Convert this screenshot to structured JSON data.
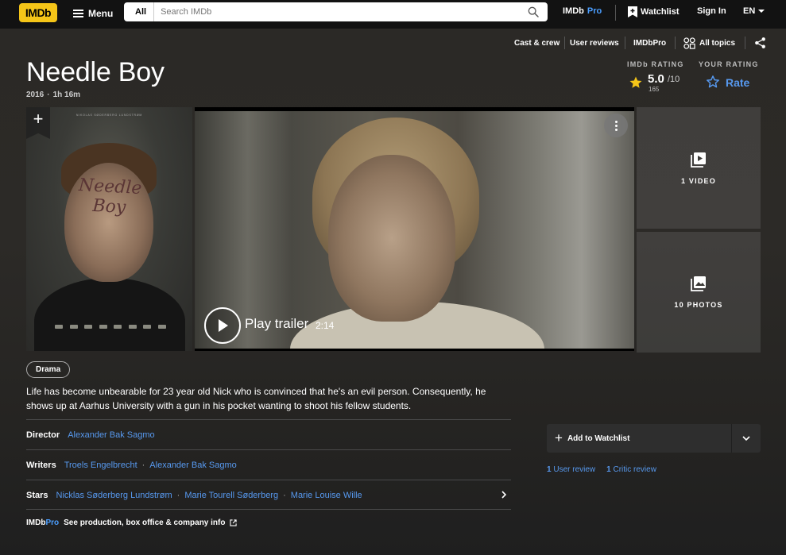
{
  "nav": {
    "logo": "IMDb",
    "menu_label": "Menu",
    "search_category": "All",
    "search_placeholder": "Search IMDb",
    "pro_prefix": "IMDb",
    "pro_suffix": "Pro",
    "watchlist_label": "Watchlist",
    "signin_label": "Sign In",
    "language": "EN"
  },
  "subnav": {
    "cast_crew": "Cast & crew",
    "user_reviews": "User reviews",
    "imdbpro": "IMDbPro",
    "all_topics": "All topics"
  },
  "title": {
    "name": "Needle Boy",
    "year": "2016",
    "runtime": "1h 16m"
  },
  "rating": {
    "imdb_label": "IMDb RATING",
    "value": "5.0",
    "scale": "/10",
    "count": "165",
    "your_label": "YOUR RATING",
    "rate_label": "Rate"
  },
  "poster": {
    "credit_line": "NIKOLAS SØDERBERG LUNDSTRØM",
    "title_art": "Needle Boy"
  },
  "video": {
    "play_label": "Play trailer",
    "duration": "2:14"
  },
  "tiles": {
    "videos": "1 VIDEO",
    "photos": "10 PHOTOS"
  },
  "genres": [
    "Drama"
  ],
  "plot": "Life has become unbearable for 23 year old Nick who is convinced that he's an evil person. Consequently, he shows up at Aarhus University with a gun in his pocket wanting to shoot his fellow students.",
  "credits": {
    "director_label": "Director",
    "directors": [
      "Alexander Bak Sagmo"
    ],
    "writers_label": "Writers",
    "writers": [
      "Troels Engelbrecht",
      "Alexander Bak Sagmo"
    ],
    "stars_label": "Stars",
    "stars": [
      "Nicklas Søderberg Lundstrøm",
      "Marie Tourell Søderberg",
      "Marie Louise Wille"
    ]
  },
  "pro_row": {
    "prefix": "IMDb",
    "suffix": "Pro",
    "text": "See production, box office & company info"
  },
  "watchlist_button": {
    "label": "Add to Watchlist"
  },
  "reviews": {
    "user_count": "1",
    "user_label": "User review",
    "critic_count": "1",
    "critic_label": "Critic review"
  },
  "colors": {
    "brand_yellow": "#f5c518",
    "link_blue": "#5799ef",
    "pro_blue": "#4b9eff"
  }
}
